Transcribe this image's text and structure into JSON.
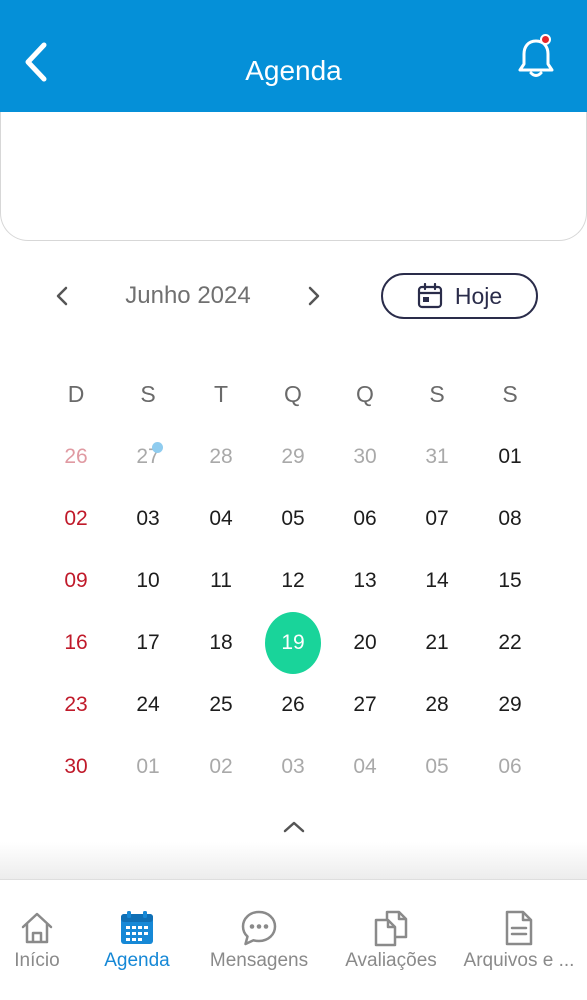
{
  "header": {
    "title": "Agenda"
  },
  "calendar": {
    "month_label": "Junho 2024",
    "today_button": "Hoje",
    "weekdays": [
      "D",
      "S",
      "T",
      "Q",
      "Q",
      "S",
      "S"
    ],
    "weeks": [
      [
        "26",
        "27",
        "28",
        "29",
        "30",
        "31",
        "01"
      ],
      [
        "02",
        "03",
        "04",
        "05",
        "06",
        "07",
        "08"
      ],
      [
        "09",
        "10",
        "11",
        "12",
        "13",
        "14",
        "15"
      ],
      [
        "16",
        "17",
        "18",
        "19",
        "20",
        "21",
        "22"
      ],
      [
        "23",
        "24",
        "25",
        "26",
        "27",
        "28",
        "29"
      ],
      [
        "30",
        "01",
        "02",
        "03",
        "04",
        "05",
        "06"
      ]
    ],
    "selected_day": "19",
    "colors": {
      "selected": "#19d49a",
      "sunday": "#c01a2a",
      "event_dot": "#8fccef"
    }
  },
  "bottom_nav": {
    "items": [
      {
        "label": "Início",
        "icon": "home-icon"
      },
      {
        "label": "Agenda",
        "icon": "calendar-icon"
      },
      {
        "label": "Mensagens",
        "icon": "chat-icon"
      },
      {
        "label": "Avaliações",
        "icon": "documents-icon"
      },
      {
        "label": "Arquivos e ...",
        "icon": "file-icon"
      }
    ],
    "active_color": "#1688d6"
  },
  "theme": {
    "primary": "#0590d8"
  }
}
